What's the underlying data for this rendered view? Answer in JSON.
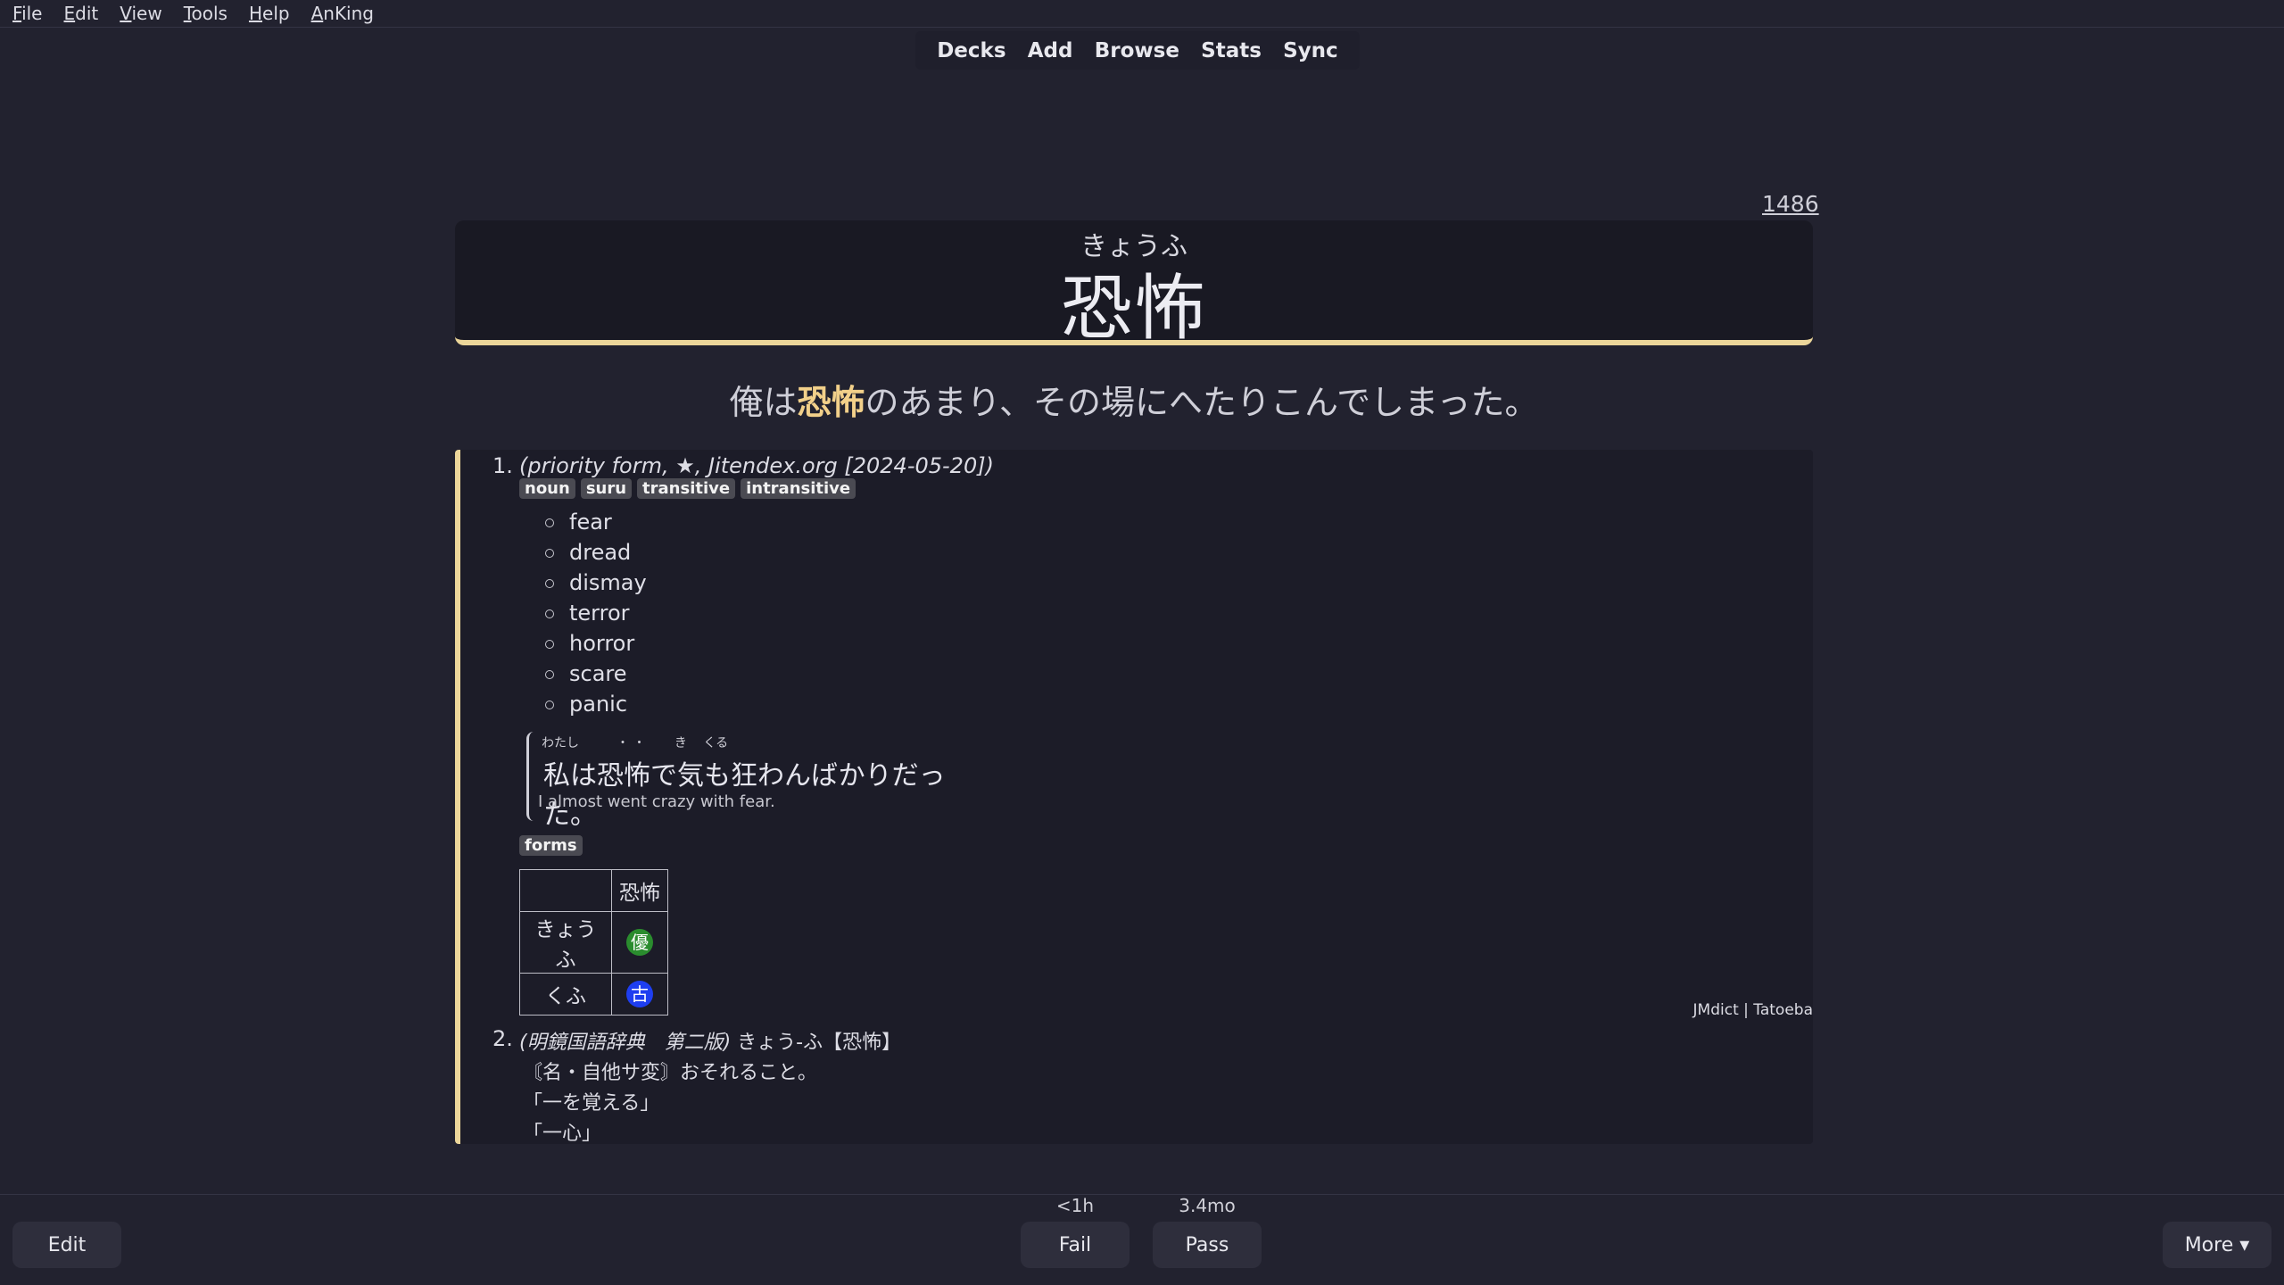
{
  "menu": [
    "File",
    "Edit",
    "View",
    "Tools",
    "Help",
    "AnKing"
  ],
  "toolbar": [
    "Decks",
    "Add",
    "Browse",
    "Stats",
    "Sync"
  ],
  "card": {
    "number": "1486",
    "reading": "きょうふ",
    "word": "恐怖",
    "sentence_before": "俺は",
    "sentence_highlight": "恐怖",
    "sentence_after": "のあまり、その場にへたりこんでしまった。"
  },
  "definition1": {
    "number": "1.",
    "source": "(priority form, ★, Jitendex.org [2024-05-20])",
    "tags": [
      "noun",
      "suru",
      "transitive",
      "intransitive"
    ],
    "glosses": [
      "fear",
      "dread",
      "dismay",
      "terror",
      "horror",
      "scare",
      "panic"
    ],
    "example": {
      "furigana": "わたし　　　・ ・　　 き　 くる",
      "japanese": "私は恐怖で気も狂わんばかりだった。",
      "english": "I almost went crazy with fear."
    },
    "forms_label": "forms",
    "forms_header": "恐怖",
    "forms_rows": [
      {
        "reading": "きょうふ",
        "badge": "優",
        "color": "#2a8c2e"
      },
      {
        "reading": "くふ",
        "badge": "古",
        "color": "#1e3ef0"
      }
    ],
    "attribution": "JMdict | Tatoeba"
  },
  "definition2": {
    "number": "2.",
    "source": "(明鏡国語辞典　第二版)",
    "headword": "きょう-ふ【恐怖】",
    "line1": "〘名・自他サ変〙おそれること。",
    "line2": "「一を覚える」",
    "line3": "「一心」"
  },
  "bottom": {
    "edit": "Edit",
    "fail_interval": "<1h",
    "fail": "Fail",
    "pass_interval": "3.4mo",
    "pass": "Pass",
    "more": "More ▾"
  }
}
